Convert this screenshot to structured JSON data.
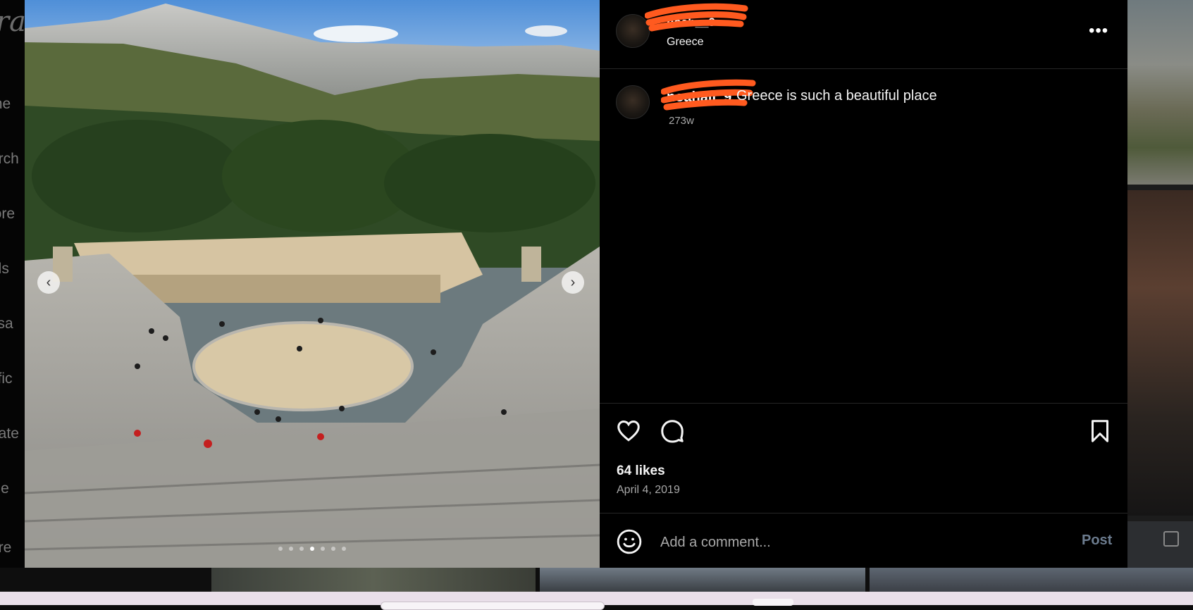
{
  "background": {
    "logo_text": "ra",
    "nav_items": [
      "me",
      "arch",
      "lore",
      "els",
      "ssa",
      "tific",
      "eate",
      "file",
      "ore"
    ]
  },
  "post": {
    "header": {
      "username": "noah__9",
      "location": "Greece",
      "more_label": "•••"
    },
    "caption": {
      "username": "noahali_9",
      "text": "Greece is such a beautiful place",
      "time": "273w"
    },
    "carousel": {
      "slide_count": 7,
      "active_index": 3,
      "prev_label": "‹",
      "next_label": "›"
    },
    "likes": "64 likes",
    "date": "April 4, 2019",
    "comment": {
      "placeholder": "Add a comment...",
      "post_label": "Post"
    },
    "colors": {
      "redaction": "#ff5a1f",
      "panel_bg": "#000000",
      "divider": "#262626",
      "muted_text": "#a8a8a8",
      "post_button": "#6c7c8f"
    },
    "icons": [
      "heart-icon",
      "comment-icon",
      "bookmark-icon",
      "emoji-icon",
      "more-options-icon"
    ]
  }
}
